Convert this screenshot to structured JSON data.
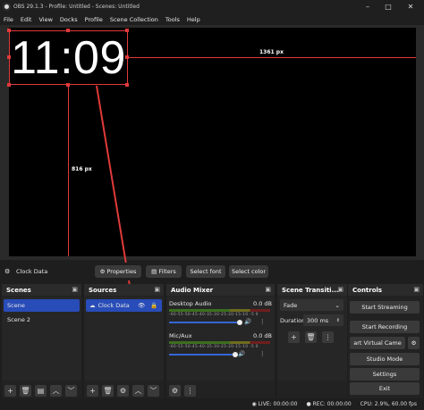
{
  "window": {
    "title": "OBS 29.1.3 - Profile: Untitled - Scenes: Untitled",
    "minimize": "–",
    "maximize": "□",
    "close": "✕"
  },
  "menu": [
    "File",
    "Edit",
    "View",
    "Docks",
    "Profile",
    "Scene Collection",
    "Tools",
    "Help"
  ],
  "preview": {
    "clock_text": "11:09",
    "width_label": "1361 px",
    "height_label": "816 px"
  },
  "source_toolbar": {
    "selected_source": "Clock Data",
    "properties": "Properties",
    "filters": "Filters",
    "select_font": "Select font",
    "select_color": "Select color"
  },
  "scenes": {
    "title": "Scenes",
    "items": [
      "Scene",
      "Scene 2"
    ]
  },
  "sources": {
    "title": "Sources",
    "items": [
      "Clock Data"
    ]
  },
  "mixer": {
    "title": "Audio Mixer",
    "channels": [
      {
        "name": "Desktop Audio",
        "db": "0.0 dB"
      },
      {
        "name": "Mic/Aux",
        "db": "0.0 dB"
      }
    ],
    "scale": [
      "-60",
      "-55",
      "-50",
      "-45",
      "-40",
      "-35",
      "-30",
      "-25",
      "-20",
      "-15",
      "-10",
      "-5",
      "0"
    ]
  },
  "transitions": {
    "title": "Scene Transiti...",
    "type": "Fade",
    "duration_label": "Duration",
    "duration_value": "300 ms"
  },
  "controls": {
    "title": "Controls",
    "start_streaming": "Start Streaming",
    "start_recording": "Start Recording",
    "virtual_camera": "art Virtual Came",
    "studio_mode": "Studio Mode",
    "settings": "Settings",
    "exit": "Exit"
  },
  "status": {
    "live": "LIVE: 00:00:00",
    "rec": "REC: 00:00:00",
    "cpu": "CPU: 2.9%, 60.00 fps"
  },
  "colors": {
    "accent": "#284cb8",
    "guide": "#e03a3a"
  }
}
